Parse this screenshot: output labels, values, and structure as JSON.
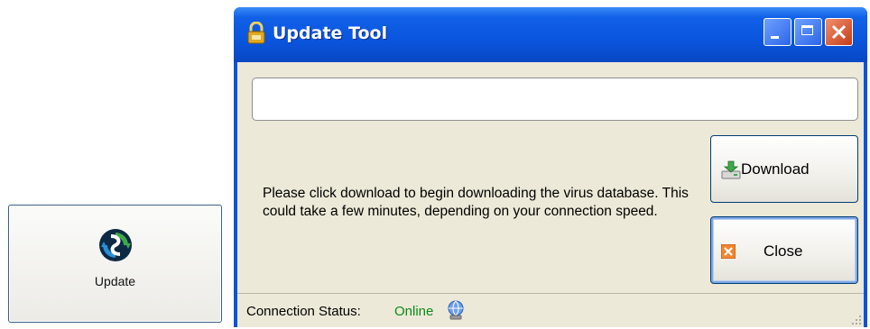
{
  "update_button": {
    "label": "Update",
    "icon": "refresh-icon"
  },
  "window": {
    "title": "Update Tool",
    "title_icon": "lock-icon",
    "progress_fraction": 0,
    "message": "Please click download to begin downloading the virus database. This could take a few minutes, depending on your connection speed.",
    "download_label": "Download",
    "download_icon": "download-drive-icon",
    "close_label": "Close",
    "close_icon": "close-x-icon",
    "status": {
      "label": "Connection Status:",
      "value": "Online",
      "value_color": "#0a8a1b",
      "icon": "network-globe-icon"
    }
  },
  "colors": {
    "titlebar": "#0a55dd",
    "client_bg": "#ece9d8",
    "button_border": "#003c74",
    "close_caption": "#c53d1b"
  }
}
